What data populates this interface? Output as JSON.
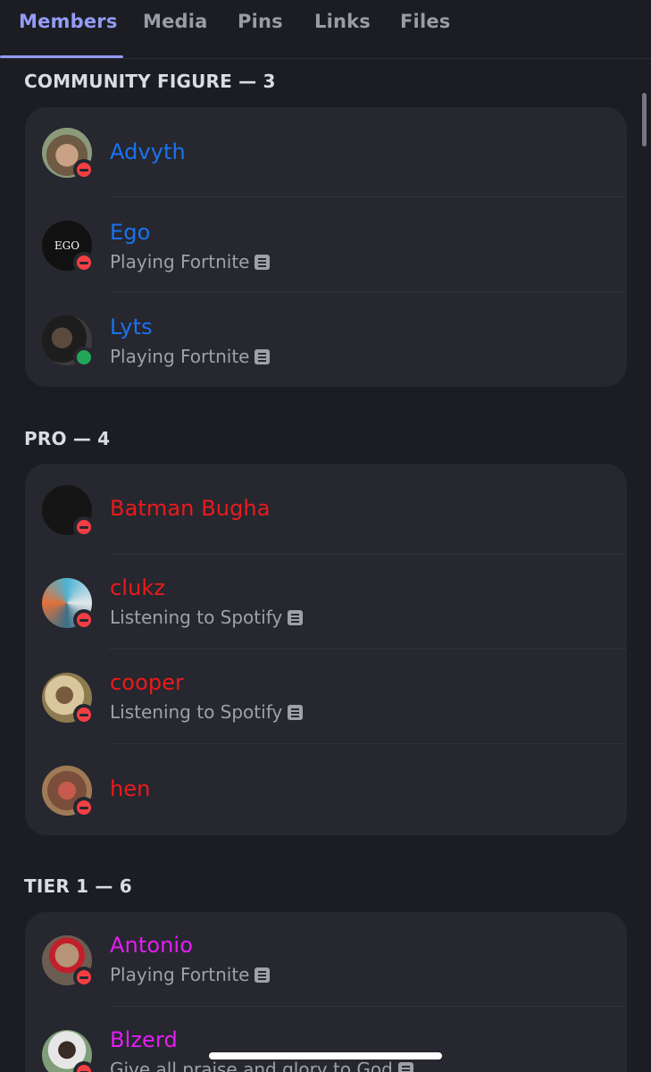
{
  "tabs": [
    {
      "label": "Members"
    },
    {
      "label": "Media"
    },
    {
      "label": "Pins"
    },
    {
      "label": "Links"
    },
    {
      "label": "Files"
    }
  ],
  "active_tab": "Members",
  "sections": [
    {
      "header": "COMMUNITY FIGURE — 3",
      "members": [
        {
          "name": "Advyth",
          "activity": "",
          "status": "dnd",
          "color": "#1a73f0"
        },
        {
          "name": "Ego",
          "activity": "Playing Fortnite",
          "status": "dnd",
          "color": "#1a73f0",
          "avatar_text": "EGO"
        },
        {
          "name": "Lyts",
          "activity": "Playing Fortnite",
          "status": "online",
          "color": "#1a73f0"
        }
      ]
    },
    {
      "header": "PRO — 4",
      "members": [
        {
          "name": "Batman Bugha",
          "activity": "",
          "status": "dnd",
          "color": "#ea1b1b"
        },
        {
          "name": "clukz",
          "activity": "Listening to Spotify",
          "status": "dnd",
          "color": "#ea1b1b"
        },
        {
          "name": "cooper",
          "activity": "Listening to Spotify",
          "status": "dnd",
          "color": "#ea1b1b"
        },
        {
          "name": "hen",
          "activity": "",
          "status": "dnd",
          "color": "#ea1b1b"
        }
      ]
    },
    {
      "header": "TIER 1 — 6",
      "members": [
        {
          "name": "Antonio",
          "activity": "Playing Fortnite",
          "status": "dnd",
          "color": "#e41ef2"
        },
        {
          "name": "Blzerd",
          "activity": "Give all praise and glory to God",
          "status": "dnd",
          "color": "#e41ef2"
        }
      ]
    }
  ],
  "icons": {
    "status_dnd": "do-not-disturb-icon",
    "status_online": "online-status-icon",
    "activity_details": "document-icon"
  }
}
